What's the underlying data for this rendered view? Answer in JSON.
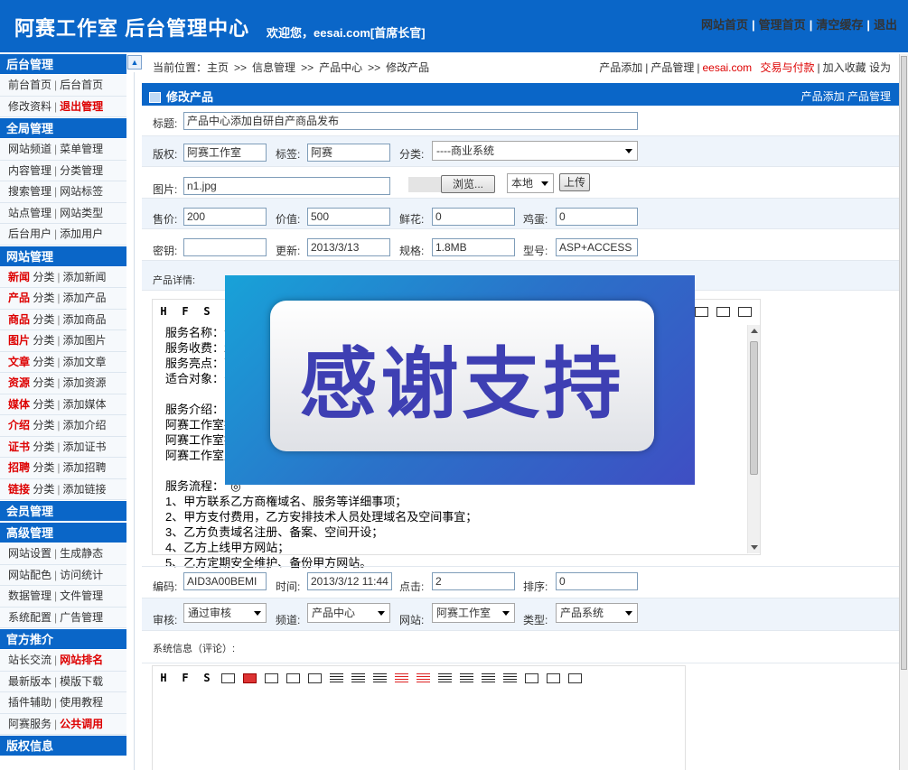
{
  "header": {
    "title": "阿赛工作室 后台管理中心",
    "welcome": "欢迎您，eesai.com[首席长官]",
    "links": [
      "网站首页",
      "管理首页",
      "清空缓存",
      "退出"
    ]
  },
  "sidebar": {
    "sections": [
      {
        "title": "后台管理",
        "rows": [
          {
            "a": "前台首页",
            "b": "后台首页"
          },
          {
            "a": "修改资料",
            "b": "退出管理",
            "b_hl": true
          }
        ]
      },
      {
        "title": "全局管理",
        "rows": [
          {
            "a": "网站频道",
            "b": "菜单管理"
          },
          {
            "a": "内容管理",
            "b": "分类管理"
          },
          {
            "a": "搜索管理",
            "b": "网站标签"
          },
          {
            "a": "站点管理",
            "b": "网站类型"
          },
          {
            "a": "后台用户",
            "b": "添加用户"
          }
        ]
      },
      {
        "title": "网站管理",
        "rows": [
          {
            "h": "新闻",
            "a": "分类",
            "b": "添加新闻"
          },
          {
            "h": "产品",
            "a": "分类",
            "b": "添加产品"
          },
          {
            "h": "商品",
            "a": "分类",
            "b": "添加商品"
          },
          {
            "h": "图片",
            "a": "分类",
            "b": "添加图片"
          },
          {
            "h": "文章",
            "a": "分类",
            "b": "添加文章"
          },
          {
            "h": "资源",
            "a": "分类",
            "b": "添加资源"
          },
          {
            "h": "媒体",
            "a": "分类",
            "b": "添加媒体"
          },
          {
            "h": "介绍",
            "a": "分类",
            "b": "添加介绍"
          },
          {
            "h": "证书",
            "a": "分类",
            "b": "添加证书"
          },
          {
            "h": "招聘",
            "a": "分类",
            "b": "添加招聘"
          },
          {
            "h": "链接",
            "a": "分类",
            "b": "添加链接"
          }
        ]
      },
      {
        "title": "会员管理",
        "rows": []
      },
      {
        "title": "高级管理",
        "rows": [
          {
            "a": "网站设置",
            "b": "生成静态"
          },
          {
            "a": "网站配色",
            "b": "访问统计"
          },
          {
            "a": "数据管理",
            "b": "文件管理"
          },
          {
            "a": "系统配置",
            "b": "广告管理"
          }
        ]
      },
      {
        "title": "官方推介",
        "rows": [
          {
            "a": "站长交流",
            "b": "网站排名",
            "b_hl": true
          },
          {
            "a": "最新版本",
            "b": "模版下载"
          },
          {
            "a": "插件辅助",
            "b": "使用教程"
          },
          {
            "a": "阿赛服务",
            "b": "公共调用",
            "b_hl": true
          }
        ]
      },
      {
        "title": "版权信息",
        "rows": []
      }
    ]
  },
  "breadcrumb": {
    "prefix": "当前位置：",
    "items": [
      "主页",
      "信息管理",
      "产品中心",
      "修改产品"
    ]
  },
  "toplinks": {
    "a": "产品添加",
    "b": "产品管理",
    "c": "eesai.com",
    "d": "交易与付款",
    "e": "加入收藏 设为"
  },
  "panel": {
    "title": "修改产品",
    "right": "产品添加 产品管理"
  },
  "form": {
    "title_label": "标题:",
    "title_value": "产品中心添加自研自产商品发布",
    "copyright_label": "版权:",
    "copyright_value": "阿赛工作室",
    "tag_label": "标签:",
    "tag_value": "阿赛",
    "category_label": "分类:",
    "category_value": "----商业系统",
    "image_label": "图片:",
    "image_value": "n1.jpg",
    "browse_label": "浏览...",
    "source_value": "本地",
    "upload_label": "上传",
    "price_label": "售价:",
    "price_value": "200",
    "value_label": "价值:",
    "value_value": "500",
    "flower_label": "鲜花:",
    "flower_value": "0",
    "egg_label": "鸡蛋:",
    "egg_value": "0",
    "key_label": "密钥:",
    "key_value": "",
    "update_label": "更新:",
    "update_value": "2013/3/13",
    "spec_label": "规格:",
    "spec_value": "1.8MB",
    "model_label": "型号:",
    "model_value": "ASP+ACCESS",
    "detail_label": "产品详情:",
    "detail_lines": [
      "服务名称：企",
      "服务收费：20",
      "服务亮点：商",
      "适合对象：公",
      "",
      "服务介绍：",
      "阿赛工作室提                                                              维护。",
      "阿赛工作室提",
      "阿赛工作室定",
      "",
      "服务流程：  ◎",
      "1、甲方联系乙方商権域名、服务等详细事项；",
      "2、甲方支付费用，乙方安排技术人员处理域名及空间事宜；",
      "3、乙方负责域名注册、备案、空间开设；",
      "4、乙方上线甲方网站；",
      "5、乙方定期安全维护、备份甲方网站。"
    ],
    "code_label": "编码:",
    "code_value": "AID3A00BEMI",
    "time_label": "时间:",
    "time_value": "2013/3/12 11:44",
    "clicks_label": "点击:",
    "clicks_value": "2",
    "order_label": "排序:",
    "order_value": "0",
    "review_label": "审核:",
    "review_value": "通过审核",
    "channel_label": "频道:",
    "channel_value": "产品中心",
    "site_label": "网站:",
    "site_value": "阿赛工作室",
    "type_label": "类型:",
    "type_value": "产品系统",
    "sysinfo_label": "系统信息（评论）:"
  },
  "toolbar_glyphs": [
    "H",
    "F",
    "S"
  ],
  "overlay": {
    "text": "感谢支持"
  },
  "colors": {
    "brand_blue": "#0a66c8",
    "highlight_red": "#dd0000"
  }
}
